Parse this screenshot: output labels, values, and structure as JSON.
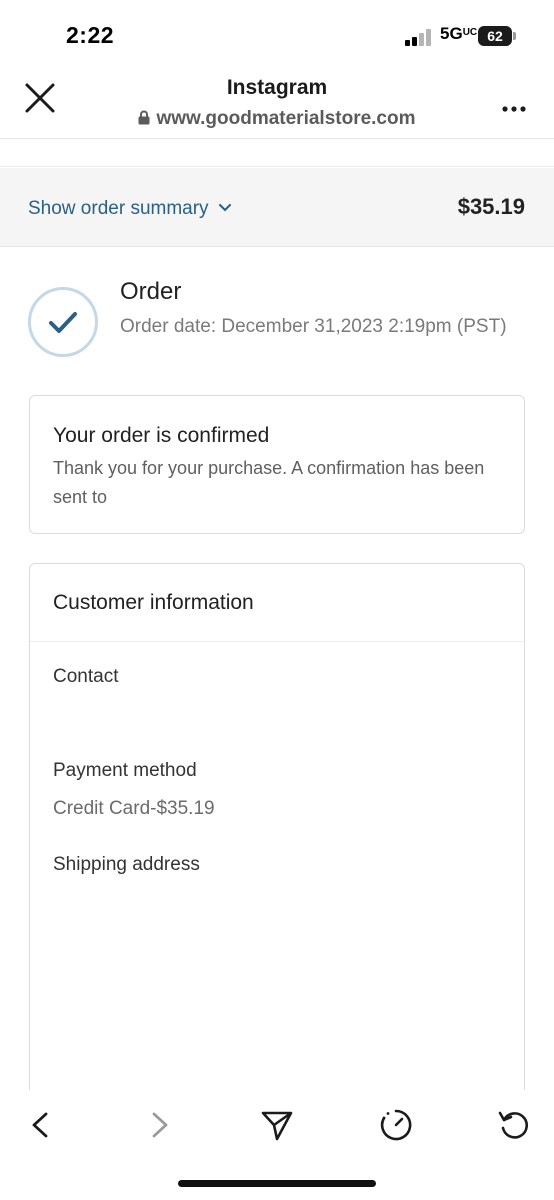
{
  "status_bar": {
    "time": "2:22",
    "network": "5G",
    "network_sub": "UC",
    "battery": "62"
  },
  "header": {
    "title": "Instagram",
    "url": "www.goodmaterialstore.com"
  },
  "summary": {
    "toggle_label": "Show order summary",
    "total": "$35.19"
  },
  "order": {
    "title": "Order",
    "date_text": "Order date:  December 31,2023 2:19pm (PST)"
  },
  "confirmation": {
    "title": "Your order is confirmed",
    "message": "Thank you for your purchase. A confirmation has been sent to"
  },
  "customer_info": {
    "title": "Customer information",
    "contact_label": "Contact",
    "payment_label": "Payment method",
    "payment_value": "Credit Card-$35.19",
    "shipping_label": "Shipping address"
  },
  "icons": {
    "close": "close-icon",
    "more": "more-icon",
    "lock": "lock-icon",
    "chevron": "chevron-down-icon",
    "check": "check-icon",
    "back": "back-icon",
    "forward": "forward-icon",
    "share": "send-icon",
    "timer": "timer-icon",
    "refresh": "refresh-icon"
  },
  "colors": {
    "accent": "#2a5f86",
    "check": "#2a5f86",
    "summary_bg": "#f5f5f5"
  }
}
